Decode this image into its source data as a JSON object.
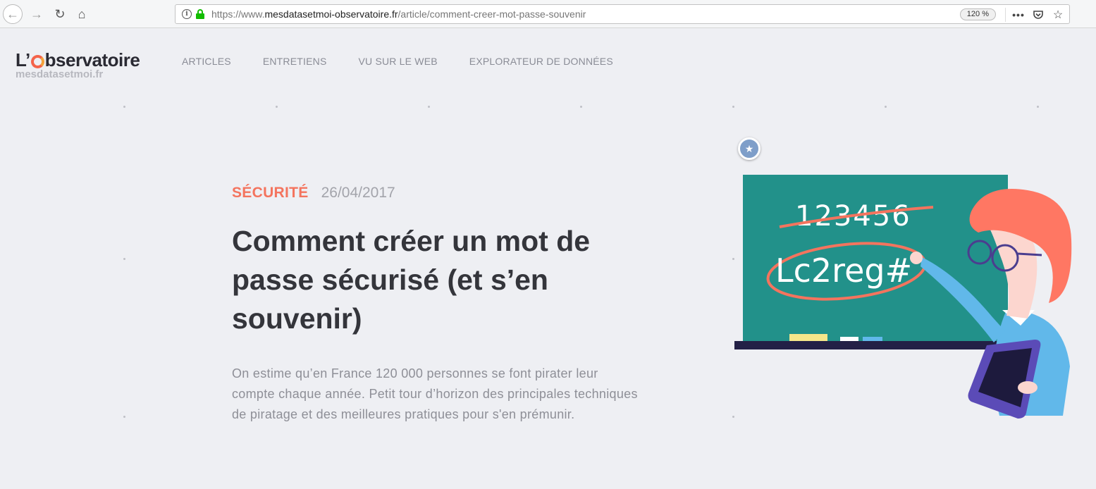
{
  "browser": {
    "url_prefix": "https://www.",
    "url_host": "mesdatasetmoi-observatoire.fr",
    "url_path": "/article/comment-creer-mot-passe-souvenir",
    "zoom": "120 %",
    "info_glyph": "i",
    "more_glyph": "•••",
    "pocket_glyph": "⌄",
    "star_glyph": "☆",
    "back_glyph": "←",
    "forward_glyph": "→",
    "reload_glyph": "↻",
    "home_glyph": "⌂"
  },
  "site": {
    "logo_prefix": "L’",
    "logo_suffix": "bservatoire",
    "logo_sub": "mesdatasetmoi.fr",
    "nav": [
      "ARTICLES",
      "ENTRETIENS",
      "VU SUR LE WEB",
      "EXPLORATEUR DE DONNÉES"
    ]
  },
  "article": {
    "category": "SÉCURITÉ",
    "date": "26/04/2017",
    "title": "Comment créer un mot de passe sécurisé (et s’en souvenir)",
    "lead": "On estime qu’en France 120 000 personnes se font pirater leur compte chaque année. Petit tour d’horizon des principales techniques de piratage et des meilleures pratiques pour s'en prémunir."
  },
  "illustration": {
    "board_crossed": "123456",
    "board_password": "Lc2reg#",
    "star_glyph": "★"
  },
  "colors": {
    "accent": "#f4745e",
    "board": "#22918a",
    "hair": "#ff7763",
    "shirt": "#61b8ea"
  }
}
